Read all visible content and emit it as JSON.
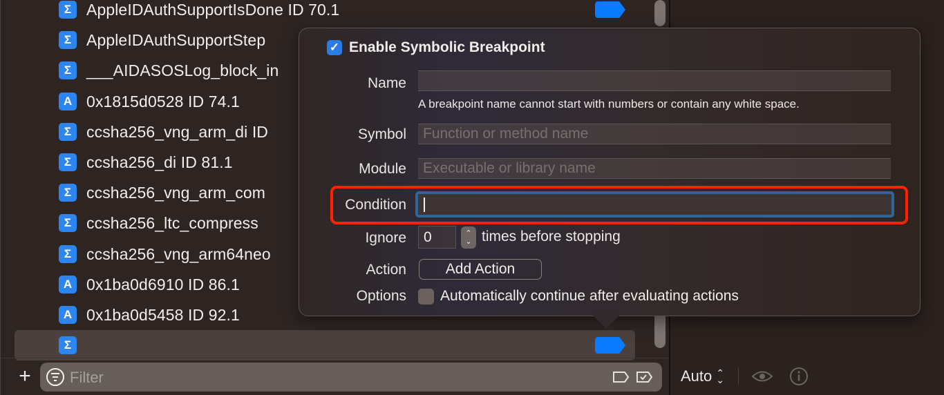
{
  "breakpoints": [
    {
      "icon": "Σ",
      "icon_type": "symbolic",
      "text": "AppleIDAuthSupportIsDone  ID 70.1",
      "enabled": true
    },
    {
      "icon": "Σ",
      "icon_type": "symbolic",
      "text": "AppleIDAuthSupportStep",
      "enabled": true
    },
    {
      "icon": "Σ",
      "icon_type": "symbolic",
      "text": "___AIDASOSLog_block_in",
      "enabled": true
    },
    {
      "icon": "A",
      "icon_type": "address",
      "text": "0x1815d0528  ID 74.1",
      "enabled": true
    },
    {
      "icon": "Σ",
      "icon_type": "symbolic",
      "text": "ccsha256_vng_arm_di ID",
      "enabled": true
    },
    {
      "icon": "Σ",
      "icon_type": "symbolic",
      "text": "ccsha256_di  ID 81.1",
      "enabled": true
    },
    {
      "icon": "Σ",
      "icon_type": "symbolic",
      "text": "ccsha256_vng_arm_com",
      "enabled": true
    },
    {
      "icon": "Σ",
      "icon_type": "symbolic",
      "text": "ccsha256_ltc_compress",
      "enabled": true
    },
    {
      "icon": "Σ",
      "icon_type": "symbolic",
      "text": "ccsha256_vng_arm64neo",
      "enabled": true
    },
    {
      "icon": "A",
      "icon_type": "address",
      "text": "0x1ba0d6910  ID 86.1",
      "enabled": true
    },
    {
      "icon": "A",
      "icon_type": "address",
      "text": "0x1ba0d5458  ID 92.1",
      "enabled": true
    },
    {
      "icon": "Σ",
      "icon_type": "symbolic",
      "text": "",
      "enabled": true,
      "selected": true
    }
  ],
  "filter": {
    "placeholder": "Filter",
    "add_label": "+"
  },
  "status_bar": {
    "mode": "Auto",
    "mode_arrows": "⌃⌄"
  },
  "popover": {
    "enable_label": "Enable Symbolic Breakpoint",
    "enable_checked": true,
    "name_label": "Name",
    "name_value": "",
    "name_hint": "A breakpoint name cannot start with numbers or contain any white space.",
    "symbol_label": "Symbol",
    "symbol_placeholder": "Function or method name",
    "module_label": "Module",
    "module_placeholder": "Executable or library name",
    "condition_label": "Condition",
    "condition_value": "",
    "ignore_label": "Ignore",
    "ignore_value": "0",
    "ignore_suffix": "times before stopping",
    "action_label": "Action",
    "add_action_label": "Add Action",
    "options_label": "Options",
    "auto_continue_label": "Automatically continue after evaluating actions",
    "auto_continue_checked": false
  },
  "colors": {
    "accent": "#0a7bff",
    "highlight": "#ff2200",
    "focus_ring": "#2e6699"
  }
}
